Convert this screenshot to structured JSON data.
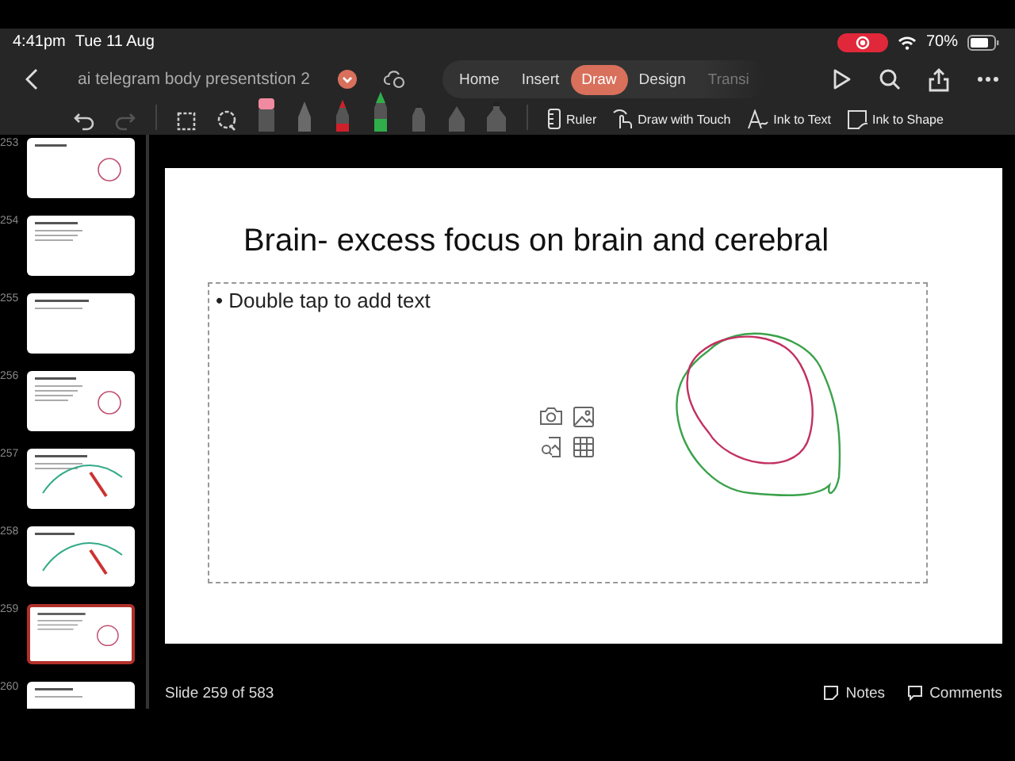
{
  "status_bar": {
    "time": "4:41pm",
    "date": "Tue 11 Aug",
    "battery": "70%"
  },
  "title_bar": {
    "document_title": "ai telegram body presentstion 2"
  },
  "tabs": [
    {
      "label": "Home",
      "selected": false
    },
    {
      "label": "Insert",
      "selected": false
    },
    {
      "label": "Draw",
      "selected": true
    },
    {
      "label": "Design",
      "selected": false
    },
    {
      "label": "Transi",
      "selected": false
    }
  ],
  "toolbar": {
    "buttons": [
      {
        "label": "Ruler",
        "kind": "ruler"
      },
      {
        "label": "Draw with Touch",
        "kind": "touch"
      },
      {
        "label": "Ink to Text",
        "kind": "text"
      },
      {
        "label": "Ink to Shape",
        "kind": "shape"
      }
    ]
  },
  "thumbnails": [
    {
      "number": "253",
      "selected": false
    },
    {
      "number": "254",
      "selected": false
    },
    {
      "number": "255",
      "selected": false
    },
    {
      "number": "256",
      "selected": false
    },
    {
      "number": "257",
      "selected": false
    },
    {
      "number": "258",
      "selected": false
    },
    {
      "number": "259",
      "selected": true
    },
    {
      "number": "260",
      "selected": false
    }
  ],
  "slide": {
    "title": "Brain- excess focus on brain and cerebral",
    "body_placeholder": "• Double tap to add text"
  },
  "footer": {
    "slide_counter": "Slide 259 of 583",
    "notes": "Notes",
    "comments": "Comments"
  }
}
